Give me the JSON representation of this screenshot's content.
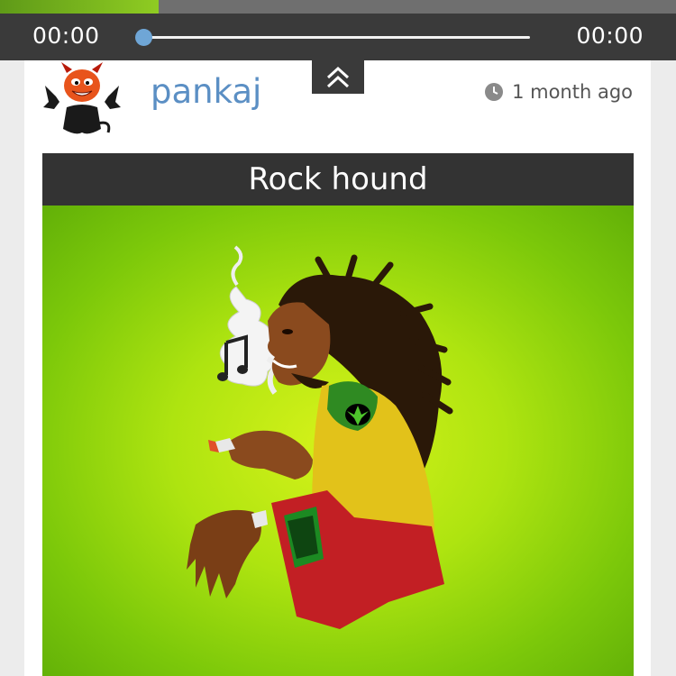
{
  "player": {
    "current_time": "00:00",
    "total_time": "00:00",
    "progress": 0
  },
  "post": {
    "author": "pankaj",
    "posted": "1 month ago",
    "title": "Rock hound"
  },
  "icons": {
    "collapse": "chevron-double-up-icon",
    "clock": "clock-icon",
    "avatar": "devil-avatar",
    "artwork": "rasta-smoking-illustration"
  },
  "colors": {
    "accent": "#6fa6d6",
    "username": "#5b8fc4",
    "bar": "#3a3a3a",
    "art_green": "#aee410"
  }
}
